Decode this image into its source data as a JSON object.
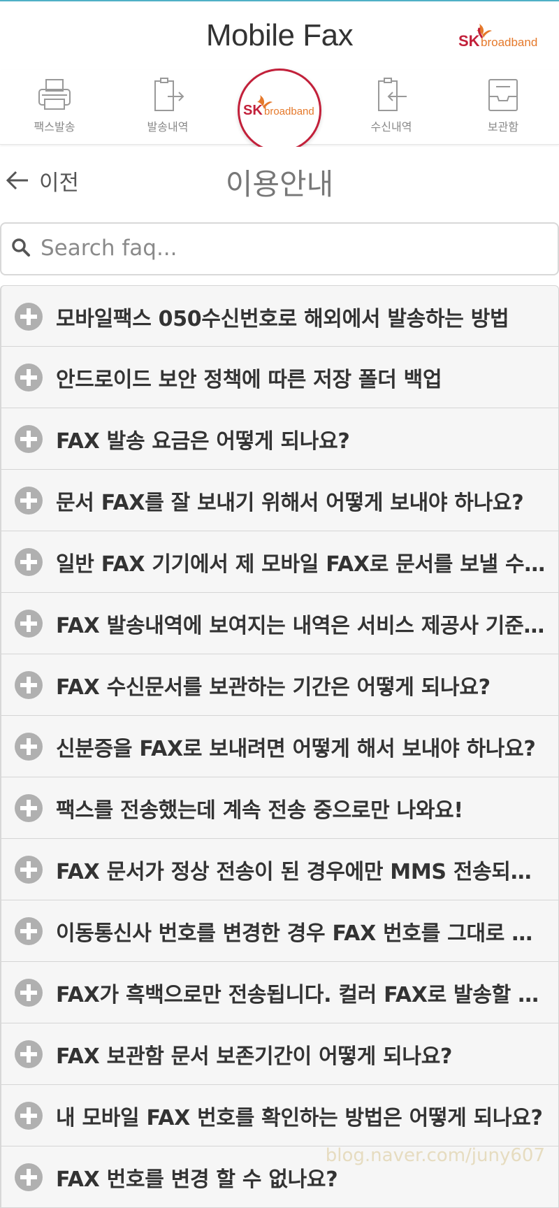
{
  "app": {
    "title": "Mobile Fax",
    "brand_logo_text_main": "SK",
    "brand_logo_text_sub": "broadband"
  },
  "nav": {
    "items": [
      {
        "label": "팩스발송",
        "icon": "fax-machine-icon"
      },
      {
        "label": "발송내역",
        "icon": "send-history-icon"
      },
      {
        "label": "수신내역",
        "icon": "receive-history-icon"
      },
      {
        "label": "보관함",
        "icon": "storage-box-icon"
      }
    ],
    "center_logo": {
      "main": "SK",
      "sub": "broadband"
    }
  },
  "subbar": {
    "back_label": "이전",
    "page_title": "이용안내"
  },
  "search": {
    "placeholder": "Search faq...",
    "value": ""
  },
  "faq": {
    "items": [
      "모바일팩스 050수신번호로 해외에서 발송하는 방법",
      "안드로이드 보안 정책에 따른 저장 폴더 백업",
      "FAX 발송 요금은 어떻게 되나요?",
      "문서 FAX를 잘 보내기 위해서 어떻게 보내야 하나요?",
      "일반 FAX 기기에서 제 모바일 FAX로 문서를 보낼 수 있나요?",
      "FAX 발송내역에 보여지는 내역은 서비스 제공사 기준인가요?",
      "FAX 수신문서를 보관하는 기간은 어떻게 되나요?",
      "신분증을 FAX로 보내려면 어떻게 해서 보내야 하나요?",
      "팩스를 전송했는데 계속 전송 중으로만 나와요!",
      "FAX 문서가 정상 전송이 된 경우에만 MMS 전송되나요?",
      "이동통신사 번호를 변경한 경우 FAX 번호를 그대로 쓸 수 있나요?",
      "FAX가 흑백으로만 전송됩니다. 컬러 FAX로 발송할 수 있나요?",
      "FAX 보관함 문서 보존기간이 어떻게 되나요?",
      "내 모바일 FAX 번호를 확인하는 방법은 어떻게 되나요?",
      "FAX 번호를 변경 할 수 없나요?"
    ]
  },
  "watermark": "blog.naver.com/juny607",
  "colors": {
    "brand_red": "#c2203a",
    "brand_orange": "#e5792b",
    "icon_gray": "#aaaaaa",
    "row_bg": "#f6f6f6"
  }
}
